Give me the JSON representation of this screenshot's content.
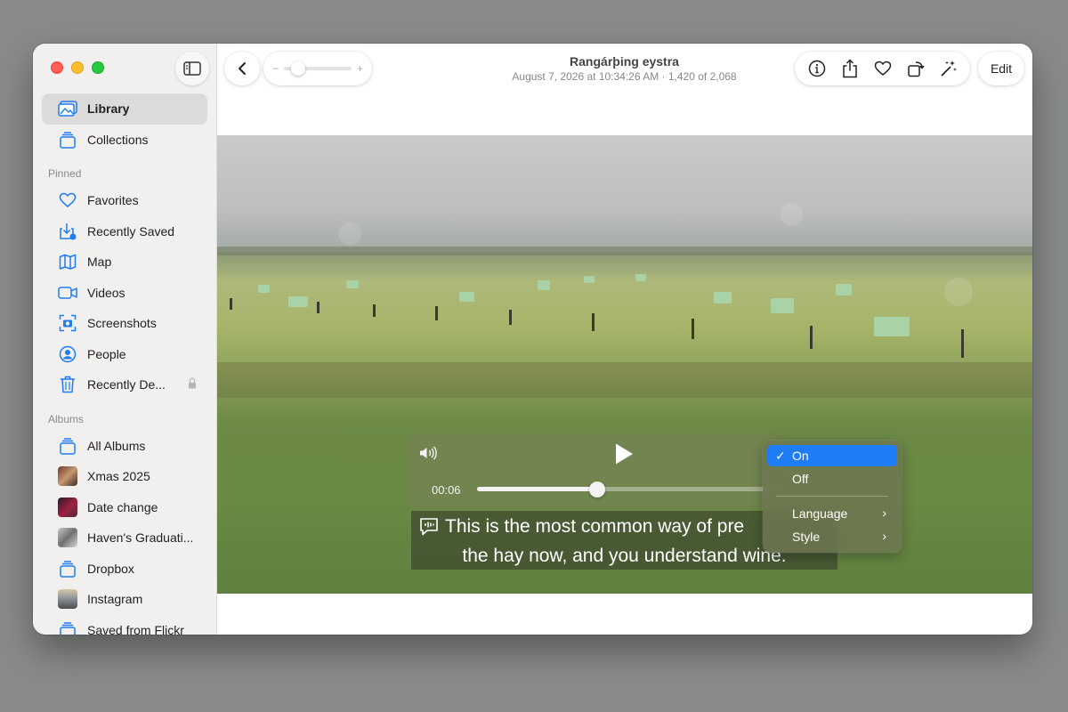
{
  "sidebar": {
    "items_top": [
      {
        "label": "Library",
        "icon": "photo-library-icon"
      },
      {
        "label": "Collections",
        "icon": "collections-icon"
      }
    ],
    "pinned_header": "Pinned",
    "pinned": [
      {
        "label": "Favorites",
        "icon": "heart-icon"
      },
      {
        "label": "Recently Saved",
        "icon": "download-icon"
      },
      {
        "label": "Map",
        "icon": "map-icon"
      },
      {
        "label": "Videos",
        "icon": "video-icon"
      },
      {
        "label": "Screenshots",
        "icon": "screenshot-icon"
      },
      {
        "label": "People",
        "icon": "person-icon"
      },
      {
        "label": "Recently De...",
        "icon": "trash-icon"
      }
    ],
    "albums_header": "Albums",
    "albums": [
      {
        "label": "All Albums",
        "icon": "albums-icon"
      },
      {
        "label": "Xmas 2025",
        "icon": "album-thumbnail"
      },
      {
        "label": "Date change",
        "icon": "album-thumbnail"
      },
      {
        "label": "Haven's Graduati...",
        "icon": "album-thumbnail"
      },
      {
        "label": "Dropbox",
        "icon": "albums-icon"
      },
      {
        "label": "Instagram",
        "icon": "album-thumbnail"
      },
      {
        "label": "Saved from Flickr",
        "icon": "albums-icon"
      }
    ]
  },
  "toolbar": {
    "title": "Rangárþing eystra",
    "subtitle": "August 7, 2026 at 10:34:26 AM  ·  1,420 of 2,068",
    "zoom_minus": "−",
    "zoom_plus": "+",
    "edit_label": "Edit"
  },
  "player": {
    "time": "00:06",
    "progress": 0.41,
    "caption_line1": "This is the most common way of pre",
    "caption_line2": "the hay now, and you understand wine."
  },
  "subtitle_menu": {
    "on": "On",
    "off": "Off",
    "language": "Language",
    "style": "Style",
    "selected": "On"
  },
  "colors": {
    "accent": "#1e7cf5",
    "close": "#ff5f57",
    "minimize": "#febc2e",
    "zoom": "#28c840"
  }
}
